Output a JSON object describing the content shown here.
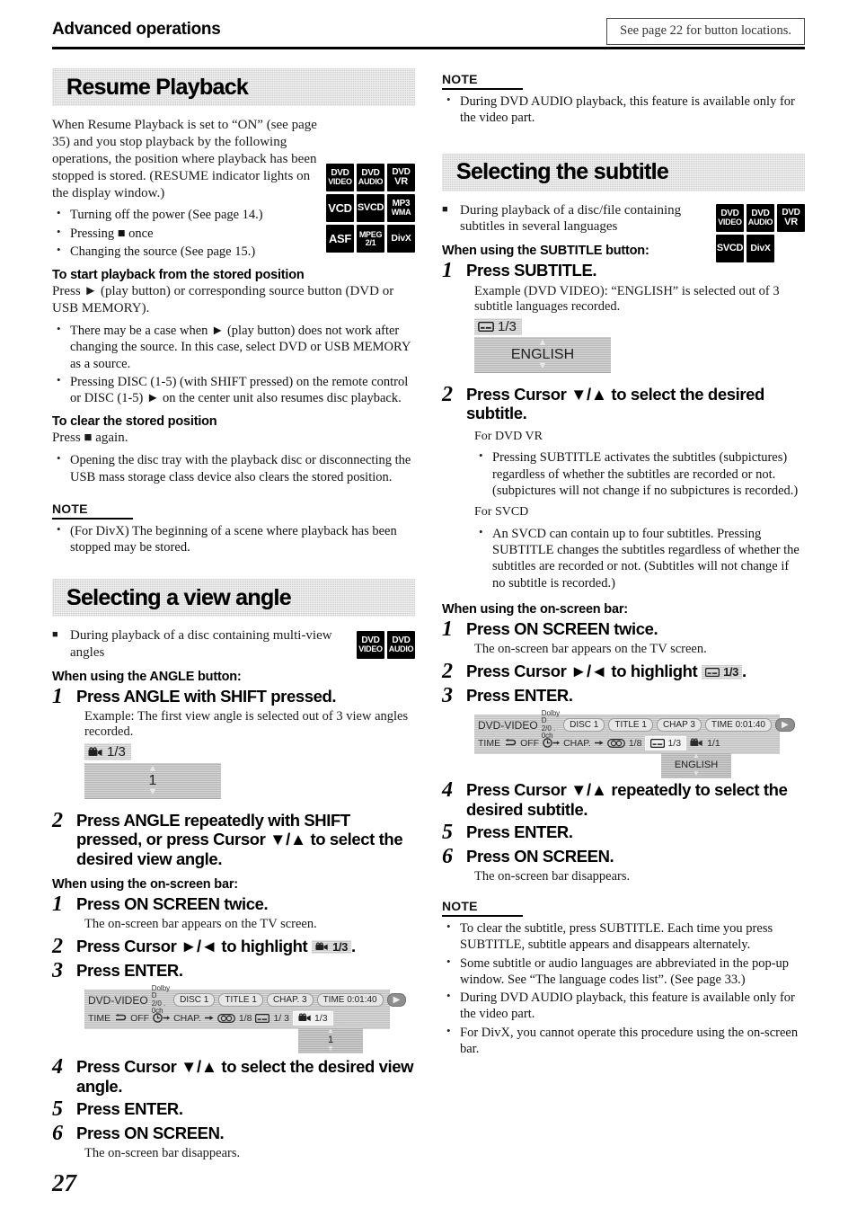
{
  "header": {
    "title": "Advanced operations",
    "reference_box": "See page 22 for button locations."
  },
  "page_number": "27",
  "left_column": {
    "section1": {
      "heading": "Resume Playback",
      "intro": "When Resume Playback is set to “ON” (see page 35) and you stop playback by the following operations, the position where playback has been stopped is stored. (RESUME indicator lights on the display window.)",
      "badges": [
        [
          "DVD VIDEO",
          "DVD AUDIO",
          "DVD VR"
        ],
        [
          "VCD",
          "SVCD",
          "MP3 WMA"
        ],
        [
          "ASF",
          "MPEG 2/1",
          "DivX"
        ]
      ],
      "bullets": [
        "Turning off the power (See page 14.)",
        "Pressing ■ once",
        "Changing the source (See page 15.)"
      ],
      "sub1_heading": "To start playback from the stored position",
      "sub1_text": "Press ► (play button) or corresponding source button (DVD or USB MEMORY).",
      "sub1_bullets": [
        "There may be a case when ► (play button) does not work after changing the source. In this case, select DVD or USB MEMORY as a source.",
        "Pressing DISC (1-5) (with SHIFT pressed) on the remote control or DISC (1-5) ► on the center unit also resumes disc playback."
      ],
      "sub2_heading": "To clear the stored position",
      "sub2_text": "Press ■ again.",
      "sub2_bullets": [
        "Opening the disc tray with the playback disc or disconnecting the USB mass storage class device also clears the stored position."
      ],
      "note_label": "NOTE",
      "note_bullets": [
        "(For DivX) The beginning of a scene where playback has been stopped may be stored."
      ]
    },
    "section2": {
      "heading": "Selecting a view angle",
      "lead": "During playback of a disc containing multi-view angles",
      "badges": [
        [
          "DVD VIDEO",
          "DVD AUDIO"
        ]
      ],
      "mode1_heading": "When using the ANGLE button:",
      "steps_button": [
        {
          "num": "1",
          "text": "Press ANGLE with SHIFT pressed.",
          "sub": "Example: The first view angle is selected out of 3 view angles recorded."
        },
        {
          "num": "2",
          "text": "Press ANGLE repeatedly with SHIFT pressed, or press Cursor ▼/▲ to select the desired view angle."
        }
      ],
      "osd_popup": {
        "icon": "angle-camera-icon",
        "counter": "1/3",
        "value": "1"
      },
      "mode2_heading": "When using the on-screen bar:",
      "steps_osd": [
        {
          "num": "1",
          "text": "Press ON SCREEN twice.",
          "sub": "The on-screen bar appears on the TV screen."
        },
        {
          "num": "2",
          "text_pre": "Press Cursor ►/◄ to highlight",
          "chip": "1/3",
          "text_post": "."
        },
        {
          "num": "3",
          "text": "Press ENTER."
        },
        {
          "num": "4",
          "text": "Press Cursor ▼/▲ to select the desired view angle."
        },
        {
          "num": "5",
          "text": "Press ENTER."
        },
        {
          "num": "6",
          "text": "Press ON SCREEN.",
          "sub": "The on-screen bar disappears."
        }
      ],
      "osbar": {
        "disc_type": "DVD-VIDEO",
        "audio_format_line1": "Dolby D",
        "audio_format_line2": "2/0 . 0ch",
        "disc": "DISC 1",
        "title": "TITLE 1",
        "chapter": "CHAP. 3",
        "time_label": "TIME",
        "time_value": "0:01:40",
        "row2_time": "TIME",
        "row2_repeat": "OFF",
        "row2_chap": "CHAP.",
        "audio_counter": "1/8",
        "subtitle_counter": "1/ 3",
        "angle_counter": "1/3",
        "dropdown_value": "1"
      }
    }
  },
  "right_column": {
    "note_top": {
      "label": "NOTE",
      "bullets": [
        "During DVD AUDIO playback, this feature is available only for the video part."
      ]
    },
    "section": {
      "heading": "Selecting the subtitle",
      "lead": "During playback of a disc/file containing subtitles in several languages",
      "badges": [
        [
          "DVD VIDEO",
          "DVD AUDIO",
          "DVD VR"
        ],
        [
          "SVCD",
          "DivX"
        ]
      ],
      "mode1_heading": "When using the SUBTITLE button:",
      "step1": {
        "num": "1",
        "text": "Press SUBTITLE.",
        "sub": "Example (DVD VIDEO): “ENGLISH” is selected out of 3 subtitle languages recorded."
      },
      "osd_popup": {
        "icon": "subtitle-icon",
        "counter": "1/3",
        "value": "ENGLISH"
      },
      "step2": {
        "num": "2",
        "text": "Press Cursor ▼/▲ to select the desired subtitle."
      },
      "dvdvr_label": "For DVD VR",
      "dvdvr_bullets": [
        "Pressing SUBTITLE activates the subtitles (subpictures) regardless of whether the subtitles are recorded or not. (subpictures will not change if no subpictures is recorded.)"
      ],
      "svcd_label": "For SVCD",
      "svcd_bullets": [
        "An SVCD can contain up to four subtitles. Pressing SUBTITLE changes the subtitles regardless of whether the subtitles are recorded or not. (Subtitles will not change if no subtitle is recorded.)"
      ],
      "mode2_heading": "When using the on-screen bar:",
      "steps_osd": [
        {
          "num": "1",
          "text": "Press ON SCREEN twice.",
          "sub": "The on-screen bar appears on the TV screen."
        },
        {
          "num": "2",
          "text_pre": "Press Cursor ►/◄ to highlight",
          "chip": "1/3",
          "text_post": "."
        },
        {
          "num": "3",
          "text": "Press ENTER."
        },
        {
          "num": "4",
          "text": "Press Cursor ▼/▲ repeatedly to select the desired subtitle."
        },
        {
          "num": "5",
          "text": "Press ENTER."
        },
        {
          "num": "6",
          "text": "Press ON SCREEN.",
          "sub": "The on-screen bar disappears."
        }
      ],
      "osbar": {
        "disc_type": "DVD-VIDEO",
        "audio_format_line1": "Dolby D",
        "audio_format_line2": "2/0 . 0ch",
        "disc": "DISC 1",
        "title": "TITLE 1",
        "chapter": "CHAP 3",
        "time_label": "TIME",
        "time_value": "0:01:40",
        "row2_time": "TIME",
        "row2_repeat": "OFF",
        "row2_chap": "CHAP.",
        "audio_counter": "1/8",
        "subtitle_counter": "1/3",
        "angle_counter": "1/1",
        "dropdown_value": "ENGLISH"
      },
      "note_label": "NOTE",
      "note_bullets": [
        "To clear the subtitle, press SUBTITLE. Each time you press SUBTITLE, subtitle appears and disappears alternately.",
        "Some subtitle or audio languages are abbreviated in the pop-up window. See “The language codes list”. (See page 33.)",
        "During DVD AUDIO playback, this feature is available only for the video part.",
        "For DivX, you cannot operate this procedure using the on-screen bar."
      ]
    }
  },
  "colors": {
    "banner_bg": "#cfcfcf",
    "badge_bg": "#000000",
    "osd_bg": "#bfbfbf"
  }
}
